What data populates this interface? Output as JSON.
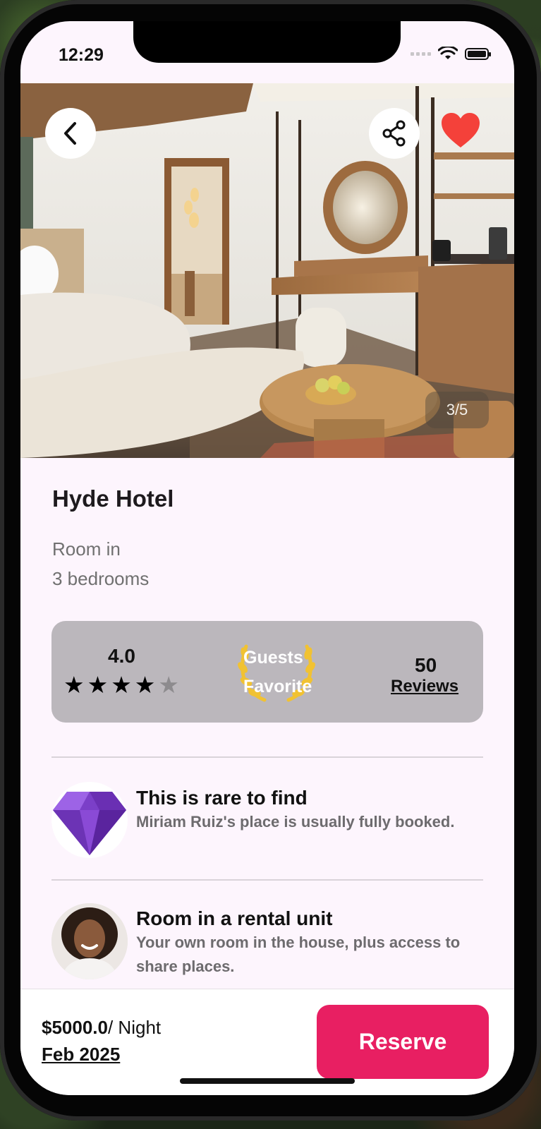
{
  "status_bar": {
    "time": "12:29"
  },
  "gallery": {
    "counter": "3/5"
  },
  "listing": {
    "name": "Hyde Hotel",
    "type_line": "Room in",
    "rooms_line": "3 bedrooms"
  },
  "rating_card": {
    "rating": "4.0",
    "stars_filled": 4,
    "stars_total": 5,
    "badge_line1": "Guests",
    "badge_line2": "Favorite",
    "reviews_count": "50",
    "reviews_label": "Reviews"
  },
  "features": [
    {
      "title": "This is rare to find",
      "description": "Miriam Ruiz's place is usually fully booked.",
      "icon": "diamond-icon"
    },
    {
      "title": "Room in a rental unit",
      "description": "Your own room in the house, plus access to share places.",
      "icon": "host-avatar"
    }
  ],
  "booking": {
    "price": "$5000.0",
    "unit": "/ Night",
    "date": "Feb 2025",
    "reserve_label": "Reserve"
  },
  "colors": {
    "accent": "#e81f62",
    "heart": "#f4413a",
    "badge_gold": "#f1c232",
    "card_bg": "#bbb7bc",
    "screen_bg": "#fdf5fd"
  }
}
